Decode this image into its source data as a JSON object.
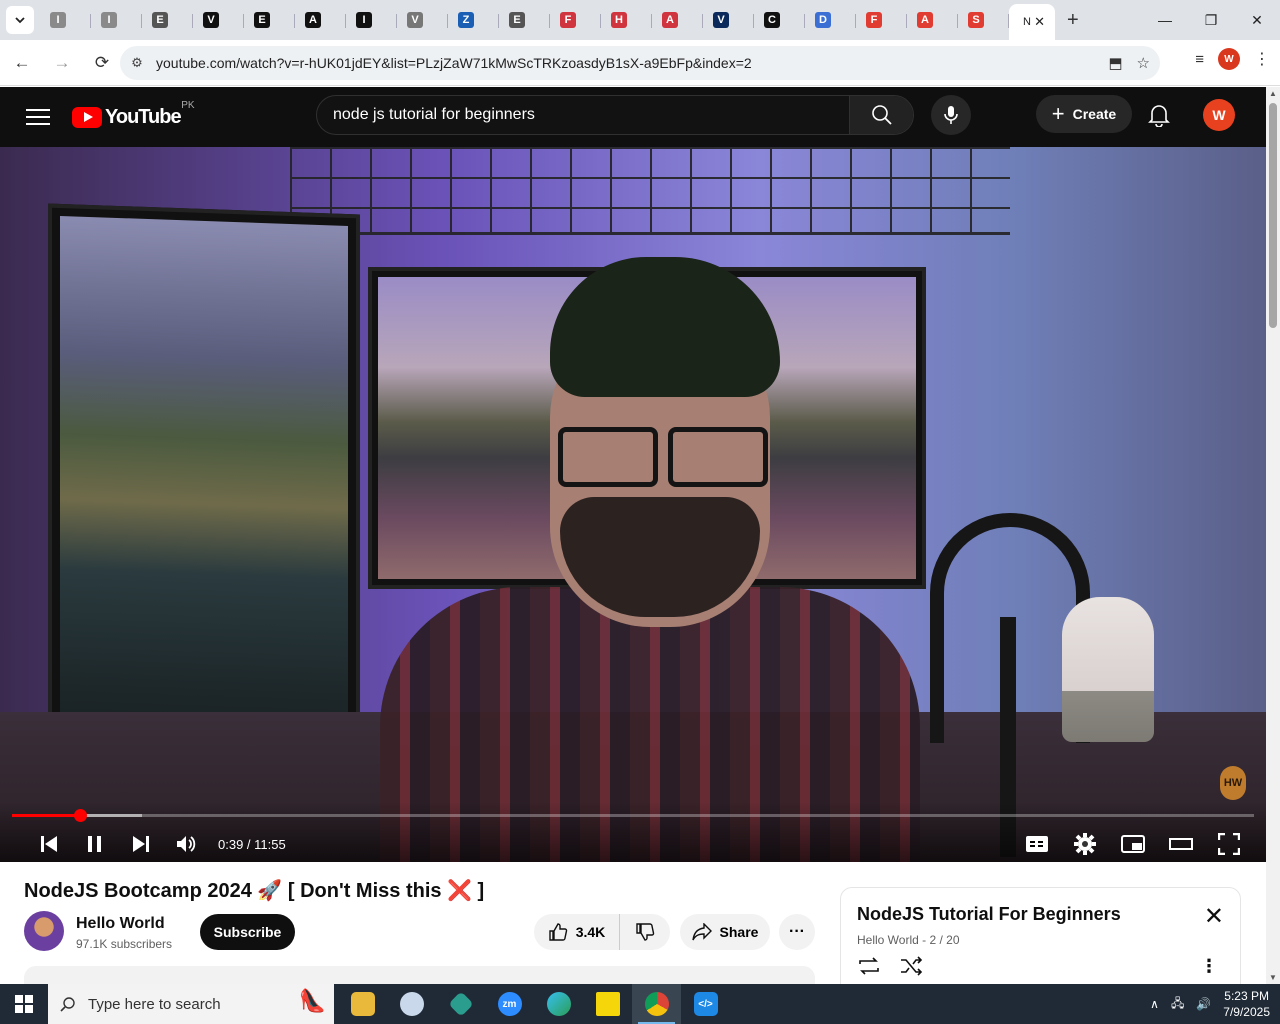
{
  "browser": {
    "tabs": [
      {
        "letter": "I",
        "color": "#8a8a8a"
      },
      {
        "letter": "I",
        "color": "#8a8a8a"
      },
      {
        "letter": "E",
        "color": "#555"
      },
      {
        "letter": "V",
        "color": "#111"
      },
      {
        "letter": "E",
        "color": "#111"
      },
      {
        "letter": "A",
        "color": "#111"
      },
      {
        "letter": "I",
        "color": "#111"
      },
      {
        "letter": "V",
        "color": "#777"
      },
      {
        "letter": "Z",
        "color": "#1a5fb4"
      },
      {
        "letter": "E",
        "color": "#555"
      },
      {
        "letter": "F",
        "color": "#d0343e"
      },
      {
        "letter": "H",
        "color": "#d0343e"
      },
      {
        "letter": "A",
        "color": "#d0343e"
      },
      {
        "letter": "V",
        "color": "#0b2a5b"
      },
      {
        "letter": "C",
        "color": "#111"
      },
      {
        "letter": "D",
        "color": "#3b6fd4"
      },
      {
        "letter": "F",
        "color": "#e03c31"
      },
      {
        "letter": "A",
        "color": "#e03c31"
      },
      {
        "letter": "S",
        "color": "#e03c31"
      }
    ],
    "active_tab_letter": "N",
    "url": "youtube.com/watch?v=r-hUK01jdEY&list=PLzjZaW71kMwScTRKzoasdyB1sX-a9EbFp&index=2",
    "profile_initial": "W"
  },
  "youtube": {
    "logo_text": "YouTube",
    "country_code": "PK",
    "search_query": "node js tutorial for beginners",
    "create_label": "Create",
    "avatar_initial": "W"
  },
  "player": {
    "current_time": "0:39",
    "duration": "11:55",
    "timecode": "0:39 / 11:55",
    "played_fraction": 0.0545,
    "buffered_fraction": 0.105,
    "watermark": "HW"
  },
  "video": {
    "title": "NodeJS Bootcamp 2024 🚀 [ Don't Miss this ❌ ]",
    "channel_name": "Hello World",
    "subscribers": "97.1K subscribers",
    "subscribe_label": "Subscribe",
    "likes": "3.4K",
    "share_label": "Share"
  },
  "playlist": {
    "title": "NodeJS Tutorial For Beginners",
    "subtitle": "Hello World - 2 / 20"
  },
  "taskbar": {
    "search_placeholder": "Type here to search",
    "time": "5:23 PM",
    "date": "7/9/2025"
  }
}
